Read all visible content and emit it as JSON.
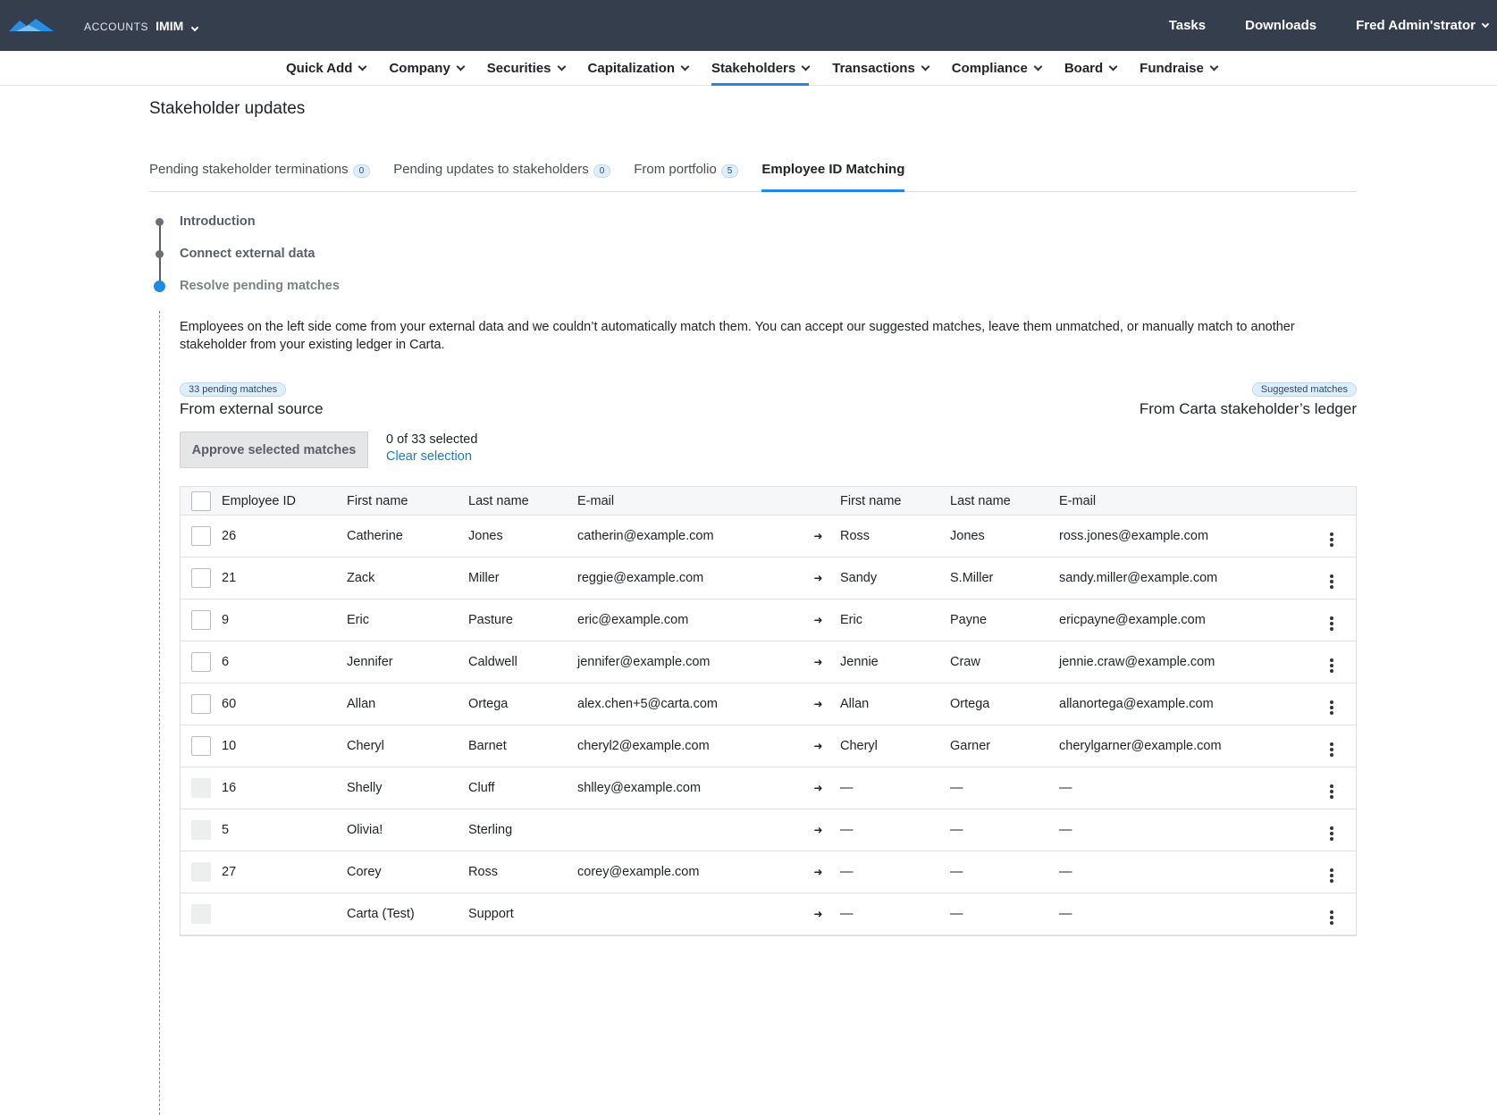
{
  "topbar": {
    "accounts_label": "ACCOUNTS",
    "account_name": "IMIM",
    "links": [
      "Tasks",
      "Downloads"
    ],
    "user": "Fred Admin'strator"
  },
  "subnav": {
    "items": [
      "Quick Add",
      "Company",
      "Securities",
      "Capitalization",
      "Stakeholders",
      "Transactions",
      "Compliance",
      "Board",
      "Fundraise"
    ],
    "active": "Stakeholders"
  },
  "page": {
    "title": "Stakeholder updates"
  },
  "tabs": [
    {
      "label": "Pending stakeholder terminations",
      "count": "0"
    },
    {
      "label": "Pending updates to stakeholders",
      "count": "0"
    },
    {
      "label": "From portfolio",
      "count": "5"
    },
    {
      "label": "Employee ID Matching",
      "count": ""
    }
  ],
  "stepper": {
    "steps": [
      "Introduction",
      "Connect external data",
      "Resolve pending matches"
    ],
    "current": "Resolve pending matches"
  },
  "description": "Employees on the left side come from your external data and we couldn’t automatically match them. You can accept our suggested matches, leave them unmatched, or manually match to another stakeholder from your existing ledger in Carta.",
  "left_source": {
    "pill": "33 pending matches",
    "title": "From external source"
  },
  "right_source": {
    "pill": "Suggested matches",
    "title": "From Carta stakeholder’s ledger"
  },
  "actions": {
    "approve_label": "Approve selected matches",
    "selected_text": "0 of 33 selected",
    "clear_label": "Clear selection"
  },
  "table": {
    "headers": {
      "employee_id": "Employee ID",
      "first_name": "First name",
      "last_name": "Last name",
      "email": "E-mail",
      "first_name2": "First name",
      "last_name2": "Last name",
      "email2": "E-mail"
    },
    "arrow": "➜",
    "rows": [
      {
        "id": "26",
        "fn": "Catherine",
        "ln": "Jones",
        "em": "catherin@example.com",
        "fn2": "Ross",
        "ln2": "Jones",
        "em2": "ross.jones@example.com",
        "cb_disabled": false
      },
      {
        "id": "21",
        "fn": "Zack",
        "ln": "Miller",
        "em": "reggie@example.com",
        "fn2": "Sandy",
        "ln2": "S.Miller",
        "em2": "sandy.miller@example.com",
        "cb_disabled": false
      },
      {
        "id": "9",
        "fn": "Eric",
        "ln": "Pasture",
        "em": "eric@example.com",
        "fn2": "Eric",
        "ln2": "Payne",
        "em2": "ericpayne@example.com",
        "cb_disabled": false
      },
      {
        "id": "6",
        "fn": "Jennifer",
        "ln": "Caldwell",
        "em": "jennifer@example.com",
        "fn2": "Jennie",
        "ln2": "Craw",
        "em2": "jennie.craw@example.com",
        "cb_disabled": false
      },
      {
        "id": "60",
        "fn": "Allan",
        "ln": "Ortega",
        "em": "alex.chen+5@carta.com",
        "fn2": "Allan",
        "ln2": "Ortega",
        "em2": "allanortega@example.com",
        "cb_disabled": false
      },
      {
        "id": "10",
        "fn": "Cheryl",
        "ln": "Barnet",
        "em": "cheryl2@example.com",
        "fn2": "Cheryl",
        "ln2": "Garner",
        "em2": "cherylgarner@example.com",
        "cb_disabled": false
      },
      {
        "id": "16",
        "fn": "Shelly",
        "ln": "Cluff",
        "em": "shlley@example.com",
        "fn2": "—",
        "ln2": "—",
        "em2": "—",
        "cb_disabled": true
      },
      {
        "id": "5",
        "fn": "Olivia!",
        "ln": "Sterling",
        "em": "",
        "fn2": "—",
        "ln2": "—",
        "em2": "—",
        "cb_disabled": true
      },
      {
        "id": "27",
        "fn": "Corey",
        "ln": "Ross",
        "em": "corey@example.com",
        "fn2": "—",
        "ln2": "—",
        "em2": "—",
        "cb_disabled": true
      },
      {
        "id": "",
        "fn": "Carta (Test)",
        "ln": "Support",
        "em": "",
        "fn2": "—",
        "ln2": "—",
        "em2": "—",
        "cb_disabled": true
      }
    ]
  }
}
